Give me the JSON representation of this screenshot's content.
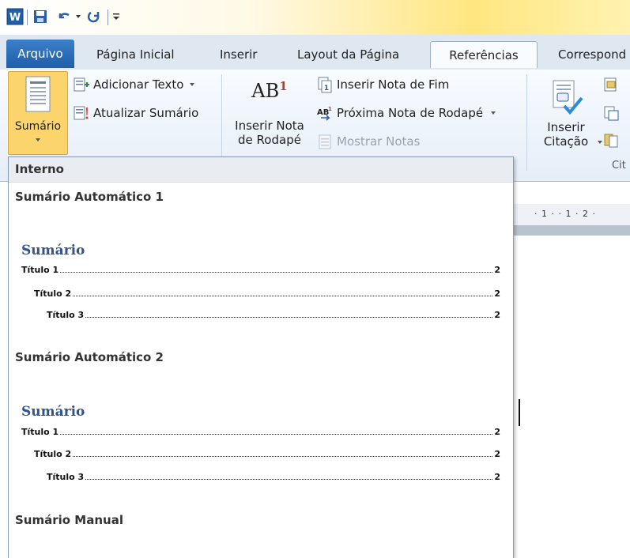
{
  "quick_access": {
    "word_icon": "W",
    "save_icon": "save-icon",
    "undo_icon": "undo-icon",
    "redo_icon": "redo-icon"
  },
  "tabs": [
    {
      "label": "Arquivo"
    },
    {
      "label": "Página Inicial"
    },
    {
      "label": "Inserir"
    },
    {
      "label": "Layout da Página"
    },
    {
      "label": "Referências"
    },
    {
      "label": "Correspond"
    }
  ],
  "ribbon": {
    "toc_button": "Sumário",
    "add_text": "Adicionar Texto",
    "update_toc": "Atualizar Sumário",
    "insert_footnote_1": "Inserir Nota",
    "insert_footnote_2": "de Rodapé",
    "insert_endnote": "Inserir Nota de Fim",
    "next_footnote": "Próxima Nota de Rodapé",
    "show_notes": "Mostrar Notas",
    "insert_citation_1": "Inserir",
    "insert_citation_2": "Citação",
    "citations_group": "Cit",
    "ab_glyph": "AB",
    "ab_super": "1"
  },
  "gallery": {
    "header": "Interno",
    "sections": [
      {
        "title": "Sumário Automático 1",
        "heading": "Sumário",
        "lines": [
          {
            "label": "Título 1",
            "page": "2"
          },
          {
            "label": "Título 2",
            "page": "2"
          },
          {
            "label": "Título 3",
            "page": "2"
          }
        ]
      },
      {
        "title": "Sumário Automático 2",
        "heading": "Sumário",
        "lines": [
          {
            "label": "Título 1",
            "page": "2"
          },
          {
            "label": "Título 2",
            "page": "2"
          },
          {
            "label": "Título 3",
            "page": "2"
          }
        ]
      },
      {
        "title": "Sumário Manual"
      }
    ]
  },
  "ruler": {
    "text": "· 1 · · 1 · 2 ·"
  },
  "colors": {
    "file_tab": "#2a6bb8",
    "heading": "#2f5491",
    "highlight": "#fbd56b"
  }
}
